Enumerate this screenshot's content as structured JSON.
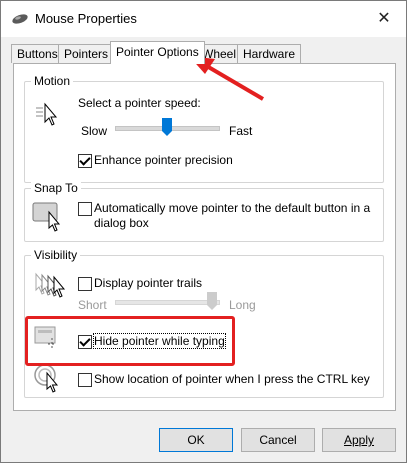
{
  "window": {
    "title": "Mouse Properties",
    "close_glyph": "✕"
  },
  "tabs": [
    {
      "label": "Buttons",
      "active": false
    },
    {
      "label": "Pointers",
      "active": false
    },
    {
      "label": "Pointer Options",
      "active": true
    },
    {
      "label": "Wheel",
      "active": false
    },
    {
      "label": "Hardware",
      "active": false
    }
  ],
  "motion": {
    "group_label": "Motion",
    "speed_label": "Select a pointer speed:",
    "slow_label": "Slow",
    "fast_label": "Fast",
    "speed_level": 0.5,
    "enhance_label": "Enhance pointer precision",
    "enhance_checked": true
  },
  "snap_to": {
    "group_label": "Snap To",
    "label_line1": "Automatically move pointer to the default button in a",
    "label_line2": "dialog box",
    "checked": false
  },
  "visibility": {
    "group_label": "Visibility",
    "trails_label": "Display pointer trails",
    "trails_checked": false,
    "short_label": "Short",
    "long_label": "Long",
    "trails_level": 1.0,
    "hide_label": "Hide pointer while typing",
    "hide_checked": true,
    "ctrl_label": "Show location of pointer when I press the CTRL key",
    "ctrl_checked": false
  },
  "buttons": {
    "ok": "OK",
    "cancel": "Cancel",
    "apply": "Apply"
  },
  "colors": {
    "accent": "#0078d7",
    "annotation": "#e32020"
  }
}
